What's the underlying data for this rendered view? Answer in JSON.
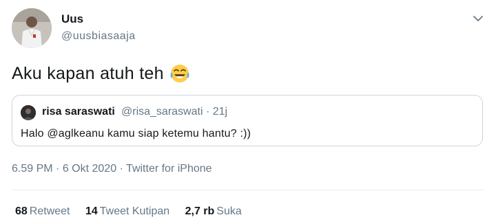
{
  "author": {
    "display_name": "Uus",
    "handle": "@uusbiasaaja"
  },
  "tweet": {
    "text": "Aku kapan atuh teh",
    "emoji_icon": "face-with-tears-of-joy-icon"
  },
  "quoted_tweet": {
    "display_name": "risa saraswati",
    "handle": "@risa_saraswati",
    "separator": "·",
    "age": "21j",
    "text": "Halo @aglkeanu kamu siap ketemu hantu? :))"
  },
  "meta": {
    "time": "6.59 PM",
    "dot1": "·",
    "date": "6 Okt 2020",
    "dot2": "·",
    "source": "Twitter for iPhone"
  },
  "stats": [
    {
      "count": "68",
      "label": "Retweet"
    },
    {
      "count": "14",
      "label": "Tweet Kutipan"
    },
    {
      "count": "2,7 rb",
      "label": "Suka"
    }
  ],
  "colors": {
    "text": "#14171a",
    "secondary": "#657786",
    "border": "#ccd6dd",
    "divider": "#e6ecf0"
  }
}
